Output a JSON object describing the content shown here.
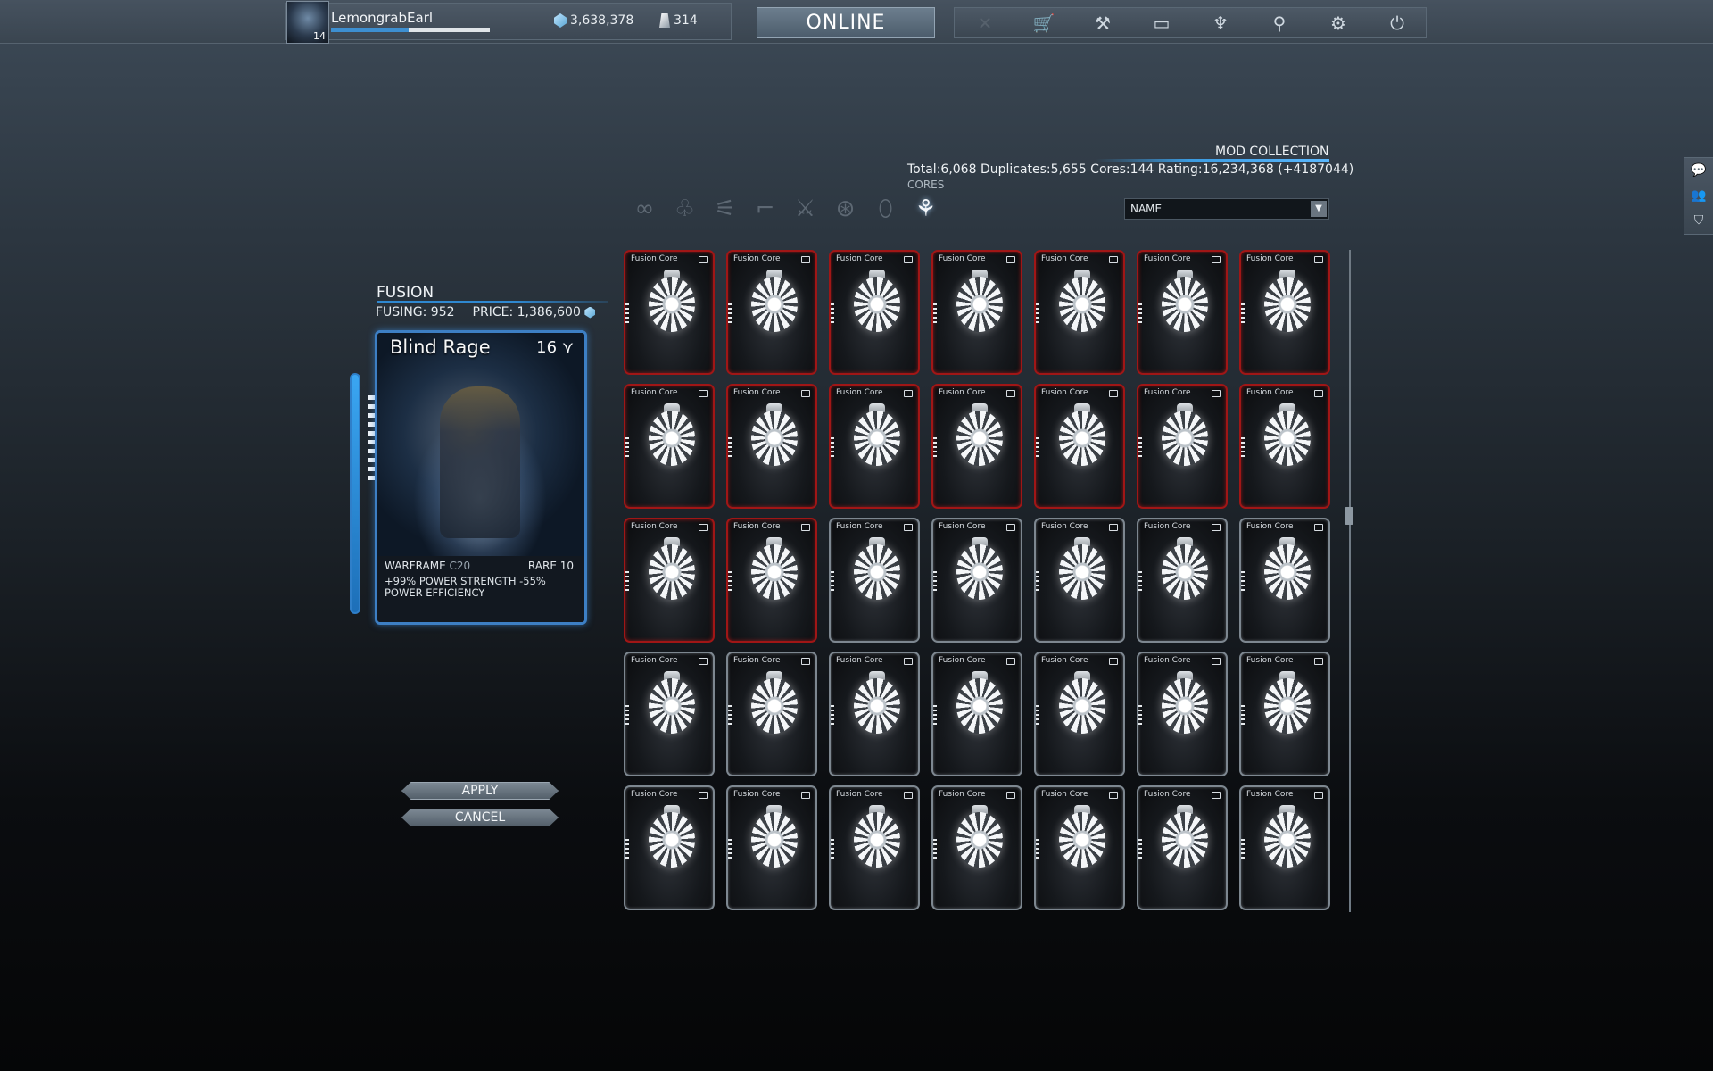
{
  "player": {
    "name": "LemongrabEarl",
    "level": "14",
    "xp_fraction": 0.49,
    "credits": "3,638,378",
    "platinum": "314"
  },
  "status_button": "ONLINE",
  "nav_icons": [
    "close-icon",
    "market-icon",
    "foundry-icon",
    "arsenal-icon",
    "mods-icon",
    "codex-icon",
    "settings-icon",
    "exit-icon"
  ],
  "side_icons": [
    "chat-icon",
    "friends-icon",
    "clan-icon"
  ],
  "fusion": {
    "title": "FUSION",
    "fusing": "FUSING: 952",
    "price": "PRICE: 1,386,600"
  },
  "mod": {
    "name": "Blind Rage",
    "rank": "16",
    "type": "WARFRAME",
    "cost": "C20",
    "rarity": "RARE 10",
    "description": "+99% POWER STRENGTH -55% POWER EFFICIENCY",
    "rank_pips": 10
  },
  "actions": {
    "apply": "APPLY",
    "cancel": "CANCEL"
  },
  "collection": {
    "title": "MOD COLLECTION",
    "stats": "Total:6,068  Duplicates:5,655  Cores:144  Rating:16,234,368 (+4187044)",
    "category": "CORES",
    "categories": [
      "all",
      "warframe",
      "primary",
      "secondary",
      "melee",
      "sentinel",
      "aura",
      "cores"
    ],
    "active_category": "cores",
    "sort": "NAME"
  },
  "cards": {
    "title": "Fusion Core",
    "rows": [
      [
        "red",
        "red",
        "red",
        "red",
        "red",
        "red",
        "red"
      ],
      [
        "red",
        "red",
        "red",
        "red",
        "red",
        "red",
        "red"
      ],
      [
        "red",
        "red",
        "silver",
        "silver",
        "silver",
        "silver",
        "silver"
      ],
      [
        "silver",
        "silver",
        "silver",
        "silver",
        "silver",
        "silver",
        "silver"
      ],
      [
        "silver",
        "silver",
        "silver",
        "silver",
        "silver",
        "silver",
        "silver"
      ]
    ]
  },
  "colors": {
    "accent_blue": "#3b9be0",
    "rare_border": "#a01616",
    "common_border": "#7d8790"
  }
}
